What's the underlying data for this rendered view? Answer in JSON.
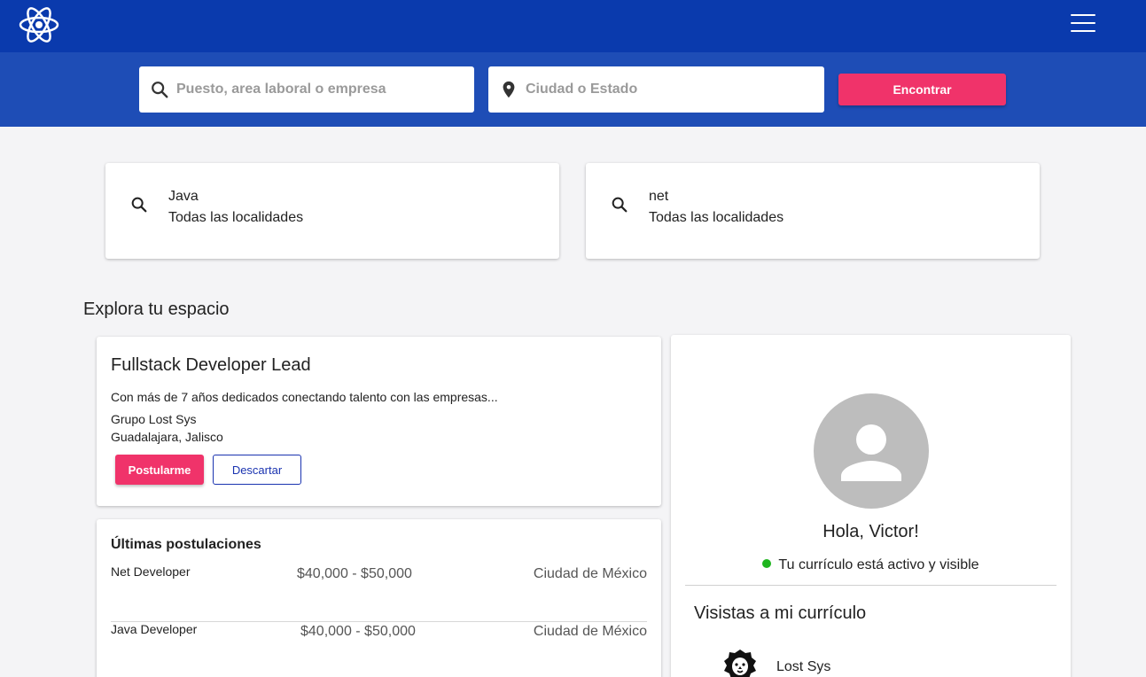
{
  "header": {
    "logo": "react-atom-logo",
    "menu_icon": "hamburger-menu-icon"
  },
  "search": {
    "job_placeholder": "Puesto, area laboral o empresa",
    "location_placeholder": "Ciudad o Estado",
    "find_label": "Encontrar"
  },
  "recent_searches": [
    {
      "query": "Java",
      "location": "Todas las localidades"
    },
    {
      "query": "net",
      "location": "Todas las localidades"
    }
  ],
  "explore": {
    "title": "Explora tu espacio",
    "job": {
      "title": "Fullstack Developer Lead",
      "description": "Con más de 7 años dedicados conectando talento con las empresas...",
      "company": "Grupo Lost Sys",
      "location": "Guadalajara, Jalisco",
      "apply_label": "Postularme",
      "discard_label": "Descartar"
    },
    "applications": {
      "title": "Últimas postulaciones",
      "rows": [
        {
          "name": "Net Developer",
          "salary": "$40,000 - $50,000",
          "city": "Ciudad de México"
        },
        {
          "name": "Java Developer",
          "salary": "$40,000 - $50,000",
          "city": "Ciudad de México"
        }
      ]
    }
  },
  "profile": {
    "greeting": "Hola, Victor!",
    "status": "Tu currículo está activo y visible",
    "status_color": "#1fb51f",
    "visits_title": "Visistas a mi currículo",
    "visits": [
      {
        "company": "Lost Sys"
      }
    ]
  },
  "colors": {
    "topbar": "#0a3aad",
    "searchbar": "#1e4db6",
    "accent": "#f0336a",
    "outline": "#1a33b0"
  }
}
